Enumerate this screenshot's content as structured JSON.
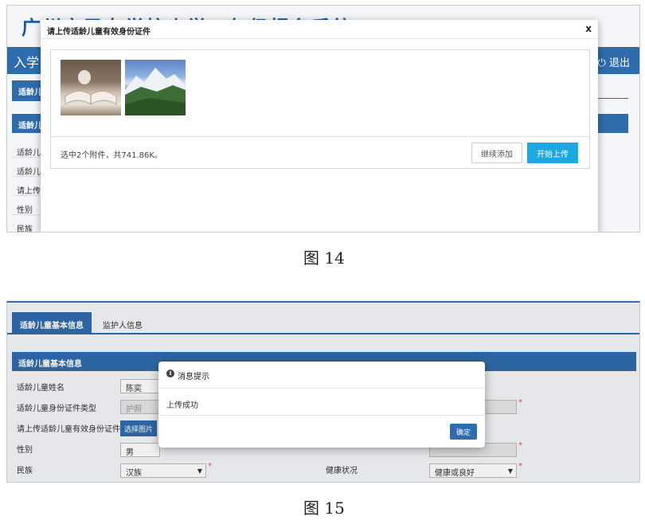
{
  "figure14": {
    "background": {
      "system_title": "广州市民办学校小学一年级报名系统",
      "nav_left": "入学",
      "logout": "退出",
      "tab_partial": "适龄儿",
      "section_partial": "适龄儿",
      "labels": [
        "适龄儿",
        "适龄儿",
        "请上传",
        "性别",
        "民族"
      ]
    },
    "dialog": {
      "title": "请上传适龄儿童有效身份证件",
      "close": "x",
      "info": "选中2个附件，共741.86K。",
      "continue_label": "继续添加",
      "start_label": "开始上传"
    },
    "caption": "图 14"
  },
  "figure15": {
    "tabs": {
      "active": "适龄儿童基本信息",
      "other": "监护人信息"
    },
    "panel_title": "适龄儿童基本信息",
    "fields": [
      {
        "label": "适龄儿童姓名",
        "value": "陈奕"
      },
      {
        "label": "适龄儿童身份证件类型",
        "value": "护照"
      },
      {
        "label": "请上传适龄儿童有效身份证件",
        "button": "选择图片"
      },
      {
        "label": "性别",
        "value": "男"
      },
      {
        "label": "民族",
        "value": "汉族"
      }
    ],
    "health": {
      "label": "健康状况",
      "value": "健康或良好"
    },
    "dialog": {
      "title": "消息提示",
      "icon": "i",
      "message": "上传成功",
      "ok_label": "确定"
    },
    "caption": "图 15"
  }
}
